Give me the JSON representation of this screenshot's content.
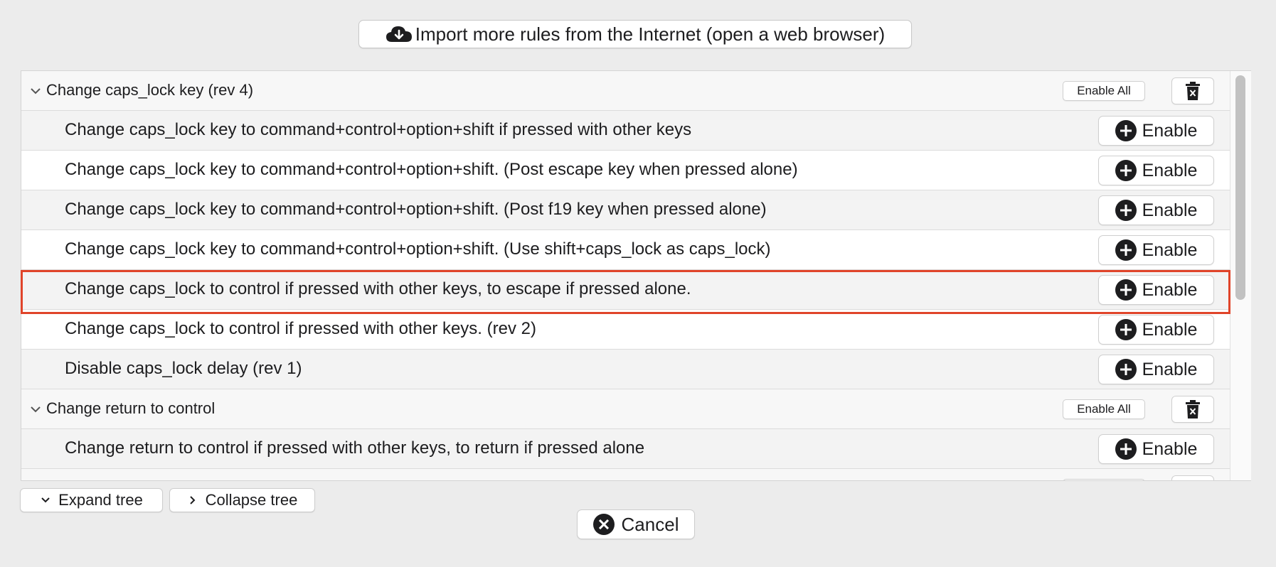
{
  "import_button": {
    "label": "Import more rules from the Internet (open a web browser)",
    "icon": "cloud-download-icon"
  },
  "groups": [
    {
      "title": "Change caps_lock key (rev 4)",
      "enable_all_label": "Enable All",
      "rules": [
        {
          "label": "Change caps_lock key to command+control+option+shift if pressed with other keys",
          "button": "Enable"
        },
        {
          "label": "Change caps_lock key to command+control+option+shift. (Post escape key when pressed alone)",
          "button": "Enable"
        },
        {
          "label": "Change caps_lock key to command+control+option+shift. (Post f19 key when pressed alone)",
          "button": "Enable"
        },
        {
          "label": "Change caps_lock key to command+control+option+shift. (Use shift+caps_lock as caps_lock)",
          "button": "Enable"
        },
        {
          "label": "Change caps_lock to control if pressed with other keys, to escape if pressed alone.",
          "button": "Enable",
          "highlighted": true
        },
        {
          "label": "Change caps_lock to control if pressed with other keys. (rev 2)",
          "button": "Enable"
        },
        {
          "label": "Disable caps_lock delay (rev 1)",
          "button": "Enable"
        }
      ]
    },
    {
      "title": "Change return to control",
      "enable_all_label": "Enable All",
      "rules": [
        {
          "label": "Change return to control if pressed with other keys, to return if pressed alone",
          "button": "Enable"
        }
      ]
    }
  ],
  "footer": {
    "expand_label": "Expand tree",
    "collapse_label": "Collapse tree",
    "cancel_label": "Cancel"
  },
  "colors": {
    "highlight_border": "#e0442a",
    "shaded_row": "#f3f3f3"
  }
}
